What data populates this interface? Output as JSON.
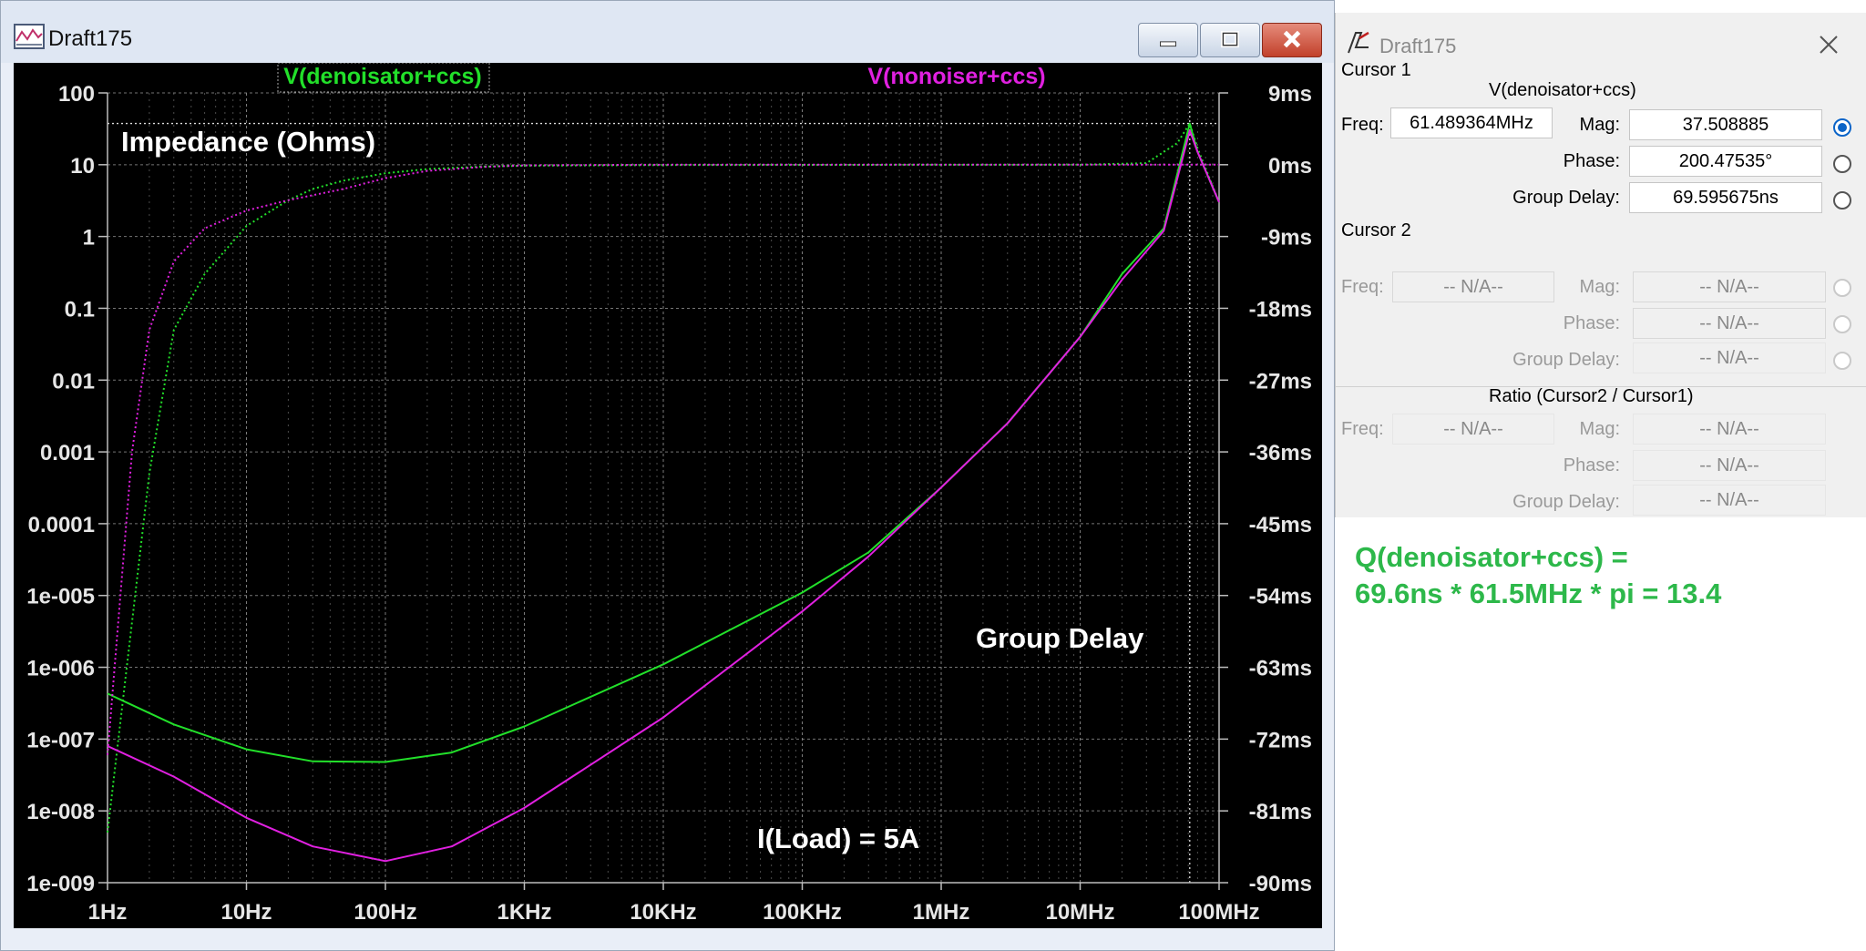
{
  "plot_window": {
    "title": "Draft175",
    "buttons": {
      "minimize": "minimize-icon",
      "maximize": "maximize-icon",
      "close": "close-icon"
    }
  },
  "chart_data": {
    "type": "line",
    "x_scale": "log",
    "x_range_hz": [
      1,
      100000000
    ],
    "x_ticks": [
      "1Hz",
      "10Hz",
      "100Hz",
      "1KHz",
      "10KHz",
      "100KHz",
      "1MHz",
      "10MHz",
      "100MHz"
    ],
    "y_left_scale": "log",
    "y_left_range": [
      1e-09,
      100
    ],
    "y_left_ticks": [
      "100",
      "10",
      "1",
      "0.1",
      "0.01",
      "0.001",
      "0.0001",
      "1e-005",
      "1e-006",
      "1e-007",
      "1e-008",
      "1e-009"
    ],
    "y_right_range_ms": [
      -90,
      9
    ],
    "y_right_ticks": [
      "9ms",
      "0ms",
      "-9ms",
      "-18ms",
      "-27ms",
      "-36ms",
      "-45ms",
      "-54ms",
      "-63ms",
      "-72ms",
      "-81ms",
      "-90ms"
    ],
    "grid": true,
    "legend_placement": "top",
    "labels": {
      "impedance": "Impedance (Ohms)",
      "group_delay": "Group Delay",
      "load": "I(Load) = 5A"
    },
    "cursor_freq_hz": 61489364,
    "cursor_mag": 37.508885,
    "series": [
      {
        "name": "V(denoisator+ccs)",
        "color": "#22e02a",
        "magnitude_ohms": [
          [
            1,
            5e-09
          ],
          [
            2,
            0.0005
          ],
          [
            3,
            0.05
          ],
          [
            5,
            0.3
          ],
          [
            10,
            1.4
          ],
          [
            20,
            3.2
          ],
          [
            30,
            4.6
          ],
          [
            50,
            6.0
          ],
          [
            100,
            7.6
          ],
          [
            200,
            8.7
          ],
          [
            500,
            9.4
          ],
          [
            1000,
            9.7
          ],
          [
            10000,
            9.9
          ],
          [
            100000,
            9.95
          ],
          [
            1000000,
            9.97
          ],
          [
            10000000,
            10
          ],
          [
            30000000,
            10.5
          ],
          [
            50000000,
            20
          ],
          [
            61489364,
            37.5
          ],
          [
            70000000,
            17
          ],
          [
            100000000,
            3
          ]
        ],
        "group_delay": [
          [
            1,
            4.3e-07
          ],
          [
            3,
            1.6e-07
          ],
          [
            10,
            7.2e-08
          ],
          [
            30,
            4.9e-08
          ],
          [
            100,
            4.8e-08
          ],
          [
            300,
            6.5e-08
          ],
          [
            1000,
            1.5e-07
          ],
          [
            10000,
            1.1e-06
          ],
          [
            100000,
            1.1e-05
          ],
          [
            300000,
            4e-05
          ],
          [
            1000000,
            0.00032
          ],
          [
            3000000,
            0.0025
          ],
          [
            10000000,
            0.04
          ],
          [
            20000000,
            0.3
          ],
          [
            40000000,
            1.3
          ],
          [
            61489364,
            37.5
          ],
          [
            70000000,
            15
          ],
          [
            100000000,
            3
          ]
        ]
      },
      {
        "name": "V(nonoiser+ccs)",
        "color": "#e020e0",
        "magnitude_ohms": [
          [
            1,
            6e-08
          ],
          [
            1.5,
            0.001
          ],
          [
            2,
            0.05
          ],
          [
            3,
            0.45
          ],
          [
            5,
            1.3
          ],
          [
            10,
            2.3
          ],
          [
            20,
            3.2
          ],
          [
            50,
            4.6
          ],
          [
            100,
            6.5
          ],
          [
            200,
            8.2
          ],
          [
            500,
            9.3
          ],
          [
            1000,
            9.8
          ],
          [
            10000,
            10
          ],
          [
            100000,
            10
          ],
          [
            1000000,
            10
          ],
          [
            10000000,
            10
          ],
          [
            100000000,
            10
          ]
        ],
        "group_delay": [
          [
            1,
            8e-08
          ],
          [
            3,
            3e-08
          ],
          [
            10,
            8e-09
          ],
          [
            30,
            3.2e-09
          ],
          [
            100,
            2e-09
          ],
          [
            300,
            3.2e-09
          ],
          [
            1000,
            1.1e-08
          ],
          [
            10000,
            2e-07
          ],
          [
            100000,
            6e-06
          ],
          [
            300000,
            3.5e-05
          ],
          [
            1000000,
            0.00032
          ],
          [
            3000000,
            0.0025
          ],
          [
            10000000,
            0.04
          ],
          [
            20000000,
            0.25
          ],
          [
            40000000,
            1.2
          ],
          [
            61489364,
            30
          ],
          [
            70000000,
            15
          ],
          [
            100000000,
            3
          ]
        ]
      }
    ]
  },
  "cursor_panel": {
    "title": "Draft175",
    "cursor1": {
      "header": "Cursor 1",
      "trace": "V(denoisator+ccs)",
      "freq_label": "Freq:",
      "freq_value": "61.489364MHz",
      "mag_label": "Mag:",
      "mag_value": "37.508885",
      "phase_label": "Phase:",
      "phase_value": "200.47535°",
      "gd_label": "Group Delay:",
      "gd_value": "69.595675ns"
    },
    "cursor2": {
      "header": "Cursor 2",
      "freq_label": "Freq:",
      "freq_value": "-- N/A--",
      "mag_label": "Mag:",
      "mag_value": "-- N/A--",
      "phase_label": "Phase:",
      "phase_value": "-- N/A--",
      "gd_label": "Group Delay:",
      "gd_value": "-- N/A--"
    },
    "ratio": {
      "header": "Ratio (Cursor2 / Cursor1)",
      "freq_label": "Freq:",
      "freq_value": "-- N/A--",
      "mag_label": "Mag:",
      "mag_value": "-- N/A--",
      "phase_label": "Phase:",
      "phase_value": "-- N/A--",
      "gd_label": "Group Delay:",
      "gd_value": "-- N/A--"
    }
  },
  "annotation": {
    "line1": "Q(denoisator+ccs) =",
    "line2": "69.6ns * 61.5MHz * pi = 13.4"
  }
}
